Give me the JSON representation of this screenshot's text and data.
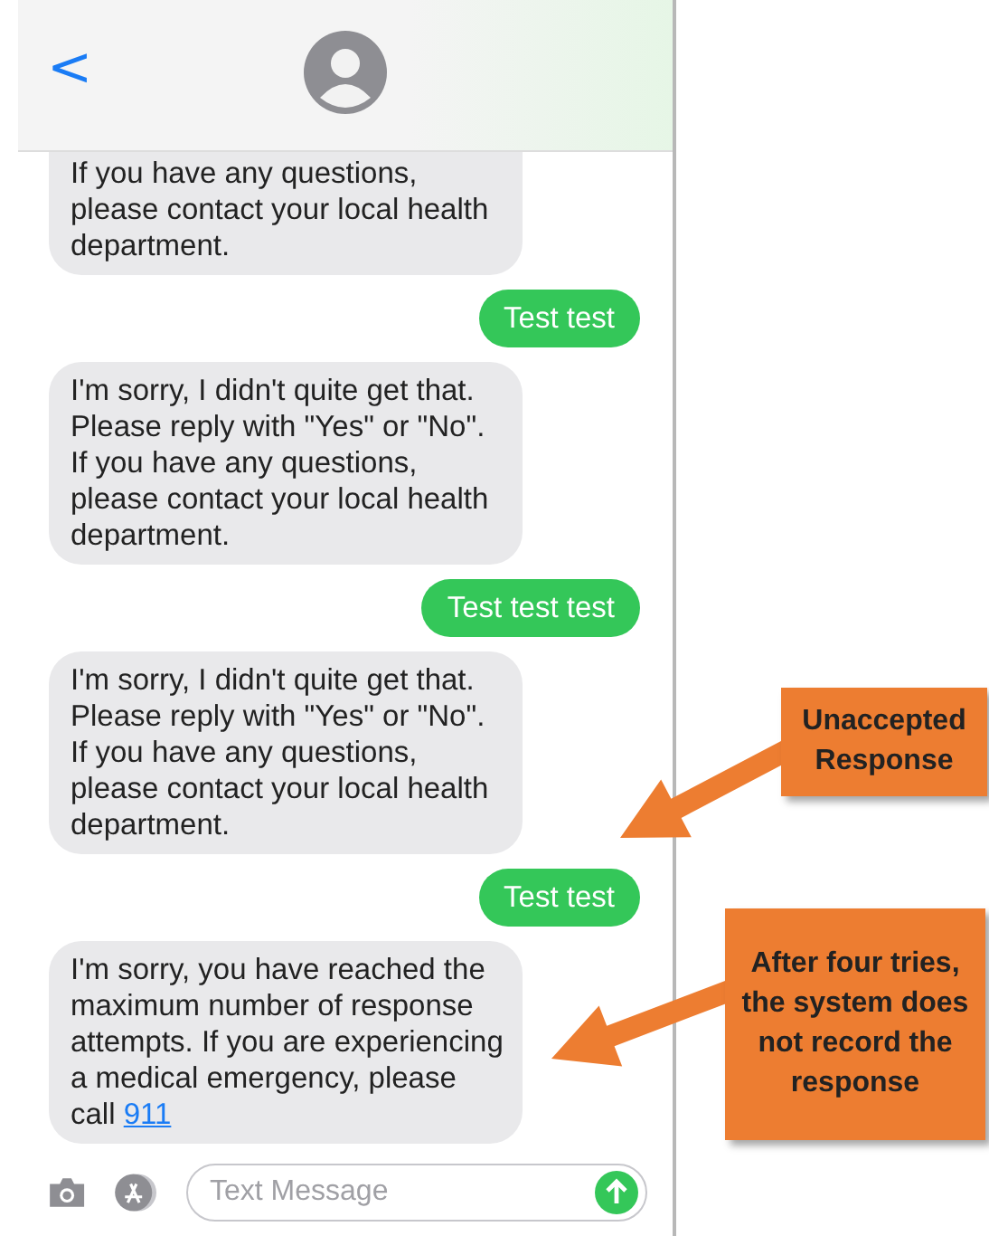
{
  "header": {
    "back": "<"
  },
  "messages": [
    {
      "kind": "received",
      "text": "If you have any questions, please contact your local health department."
    },
    {
      "kind": "sent",
      "text": "Test test"
    },
    {
      "kind": "received",
      "text": "I'm sorry, I didn't quite get that. Please reply with \"Yes\" or \"No\". If you have any questions, please contact your local health department."
    },
    {
      "kind": "sent",
      "text": "Test test test"
    },
    {
      "kind": "received",
      "text": "I'm sorry, I didn't quite get that. Please reply with \"Yes\" or \"No\". If you have any questions, please contact your local health department."
    },
    {
      "kind": "sent",
      "text": "Test test"
    },
    {
      "kind": "received",
      "text": "I'm sorry, you have reached the maximum number of response attempts. If you are experiencing a medical emergency, please call",
      "link": "911"
    }
  ],
  "composer": {
    "placeholder": "Text Message"
  },
  "annotations": [
    {
      "text": "Unaccepted Response"
    },
    {
      "text": "After four tries, the system does not record the response"
    }
  ]
}
